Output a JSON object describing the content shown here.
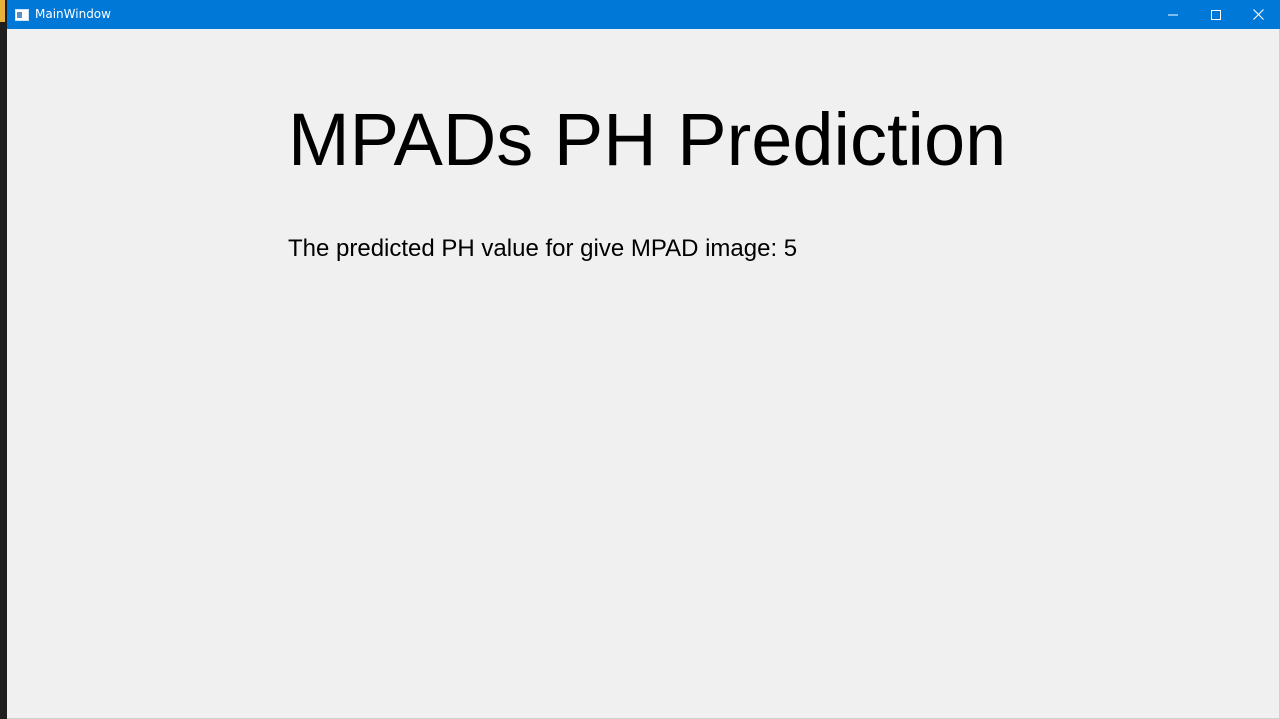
{
  "window": {
    "title": "MainWindow",
    "titlebar_color": "#0078d7",
    "background_color": "#f0f0f0"
  },
  "caption_buttons": {
    "minimize_icon": "minimize-icon",
    "maximize_icon": "maximize-icon",
    "close_icon": "close-icon"
  },
  "main": {
    "heading": "MPADs PH Prediction",
    "result_label": "The predicted PH value for give MPAD image: ",
    "result_value": "5"
  }
}
